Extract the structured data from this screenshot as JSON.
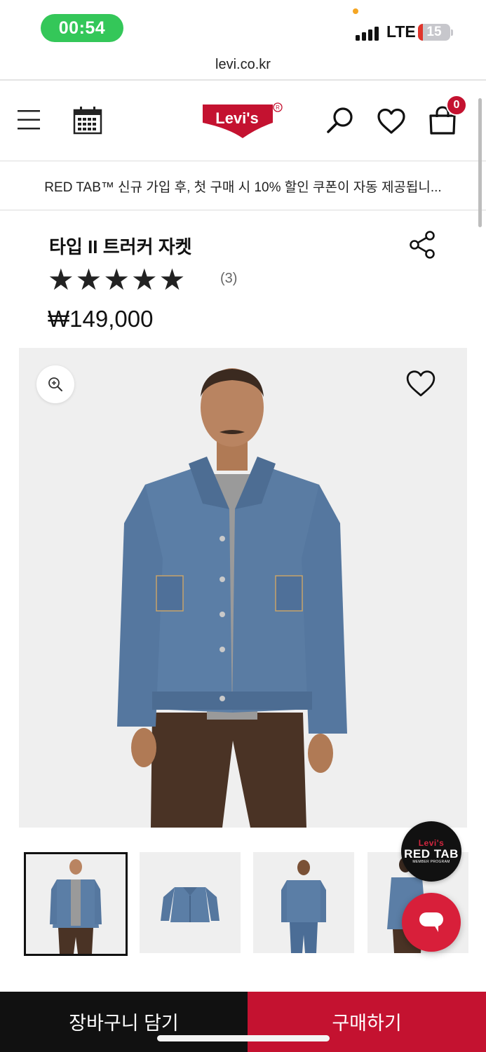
{
  "status_bar": {
    "time": "00:54",
    "network": "LTE",
    "battery": "15",
    "battery_fraction": 0.15
  },
  "browser": {
    "url": "levi.co.kr"
  },
  "header": {
    "logo_text": "Levi's",
    "cart_count": "0"
  },
  "promo": {
    "text": "RED TAB™ 신규 가입 후, 첫 구매 시 10% 할인 쿠폰이 자동 제공됩니..."
  },
  "product": {
    "title": "타입 II 트러커 자켓",
    "rating_stars": 5,
    "review_count": "(3)",
    "price": "₩149,000"
  },
  "gallery": {
    "thumbnail_count": 4,
    "selected_index": 0
  },
  "floating": {
    "redtab_line1": "Levi's",
    "redtab_line2": "RED TAB",
    "redtab_line3": "MEMBER PROGRAM"
  },
  "actions": {
    "add_to_cart": "장바구니 담기",
    "buy_now": "구매하기"
  },
  "colors": {
    "brand_red": "#c41230",
    "status_green": "#34c759"
  }
}
